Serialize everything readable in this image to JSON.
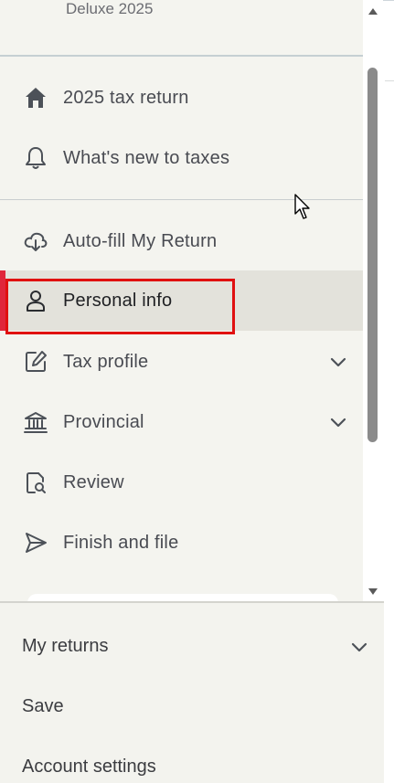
{
  "header": {
    "product_name": "Deluxe 2025"
  },
  "nav": {
    "items": [
      {
        "label": "2025 tax return",
        "icon": "house-icon"
      },
      {
        "label": "What's new to taxes",
        "icon": "bell-icon"
      },
      {
        "label": "Auto-fill My Return",
        "icon": "cloud-download-icon"
      },
      {
        "label": "Personal info",
        "icon": "person-icon",
        "active": true
      },
      {
        "label": "Tax profile",
        "icon": "edit-icon",
        "expandable": true
      },
      {
        "label": "Provincial",
        "icon": "government-building-icon",
        "expandable": true
      },
      {
        "label": "Review",
        "icon": "document-search-icon"
      },
      {
        "label": "Finish and file",
        "icon": "send-icon"
      }
    ]
  },
  "footer": {
    "items": [
      {
        "label": "My returns",
        "expandable": true
      },
      {
        "label": "Save"
      },
      {
        "label": "Account settings"
      }
    ]
  },
  "colors": {
    "sidebar_bg": "#f4f4ef",
    "active_bg": "#e3e2db",
    "active_indicator": "#e0263a",
    "highlight_box": "#e01010",
    "text": "#494b52"
  }
}
